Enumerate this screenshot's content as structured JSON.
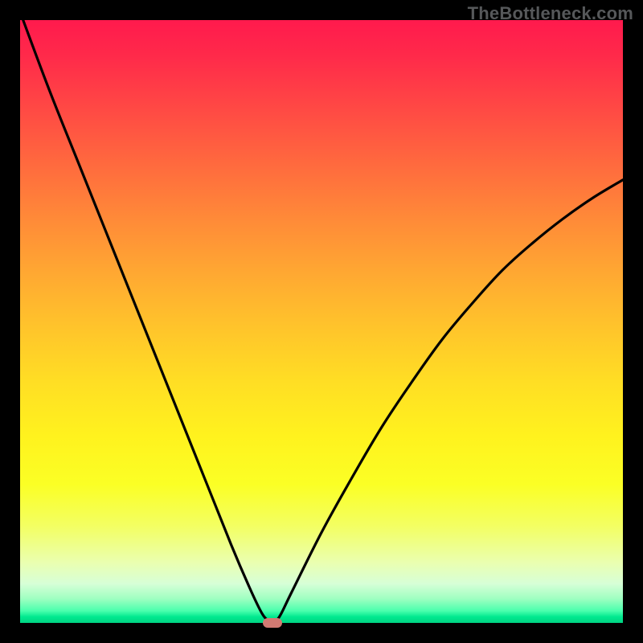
{
  "watermark": "TheBottleneck.com",
  "chart_data": {
    "type": "line",
    "title": "",
    "xlabel": "",
    "ylabel": "",
    "xlim": [
      0,
      100
    ],
    "ylim": [
      0,
      100
    ],
    "grid": false,
    "series": [
      {
        "name": "curve",
        "x": [
          0.5,
          5,
          10,
          15,
          20,
          25,
          30,
          35,
          38,
          40,
          41,
          41.8,
          43,
          45,
          50,
          55,
          60,
          65,
          70,
          75,
          80,
          85,
          90,
          95,
          100
        ],
        "values": [
          100,
          88,
          75.5,
          63,
          50.5,
          38,
          25.5,
          13,
          6,
          1.8,
          0.5,
          0,
          1,
          5,
          15,
          24,
          32.5,
          40,
          47,
          53,
          58.5,
          63,
          67,
          70.5,
          73.5
        ]
      }
    ],
    "marker": {
      "x": 41.8,
      "y": 0
    },
    "colors": {
      "curve": "#000000",
      "marker": "#d27a73",
      "gradient_top": "#ff1a4d",
      "gradient_mid": "#ffe01e",
      "gradient_bottom": "#00d483"
    }
  }
}
